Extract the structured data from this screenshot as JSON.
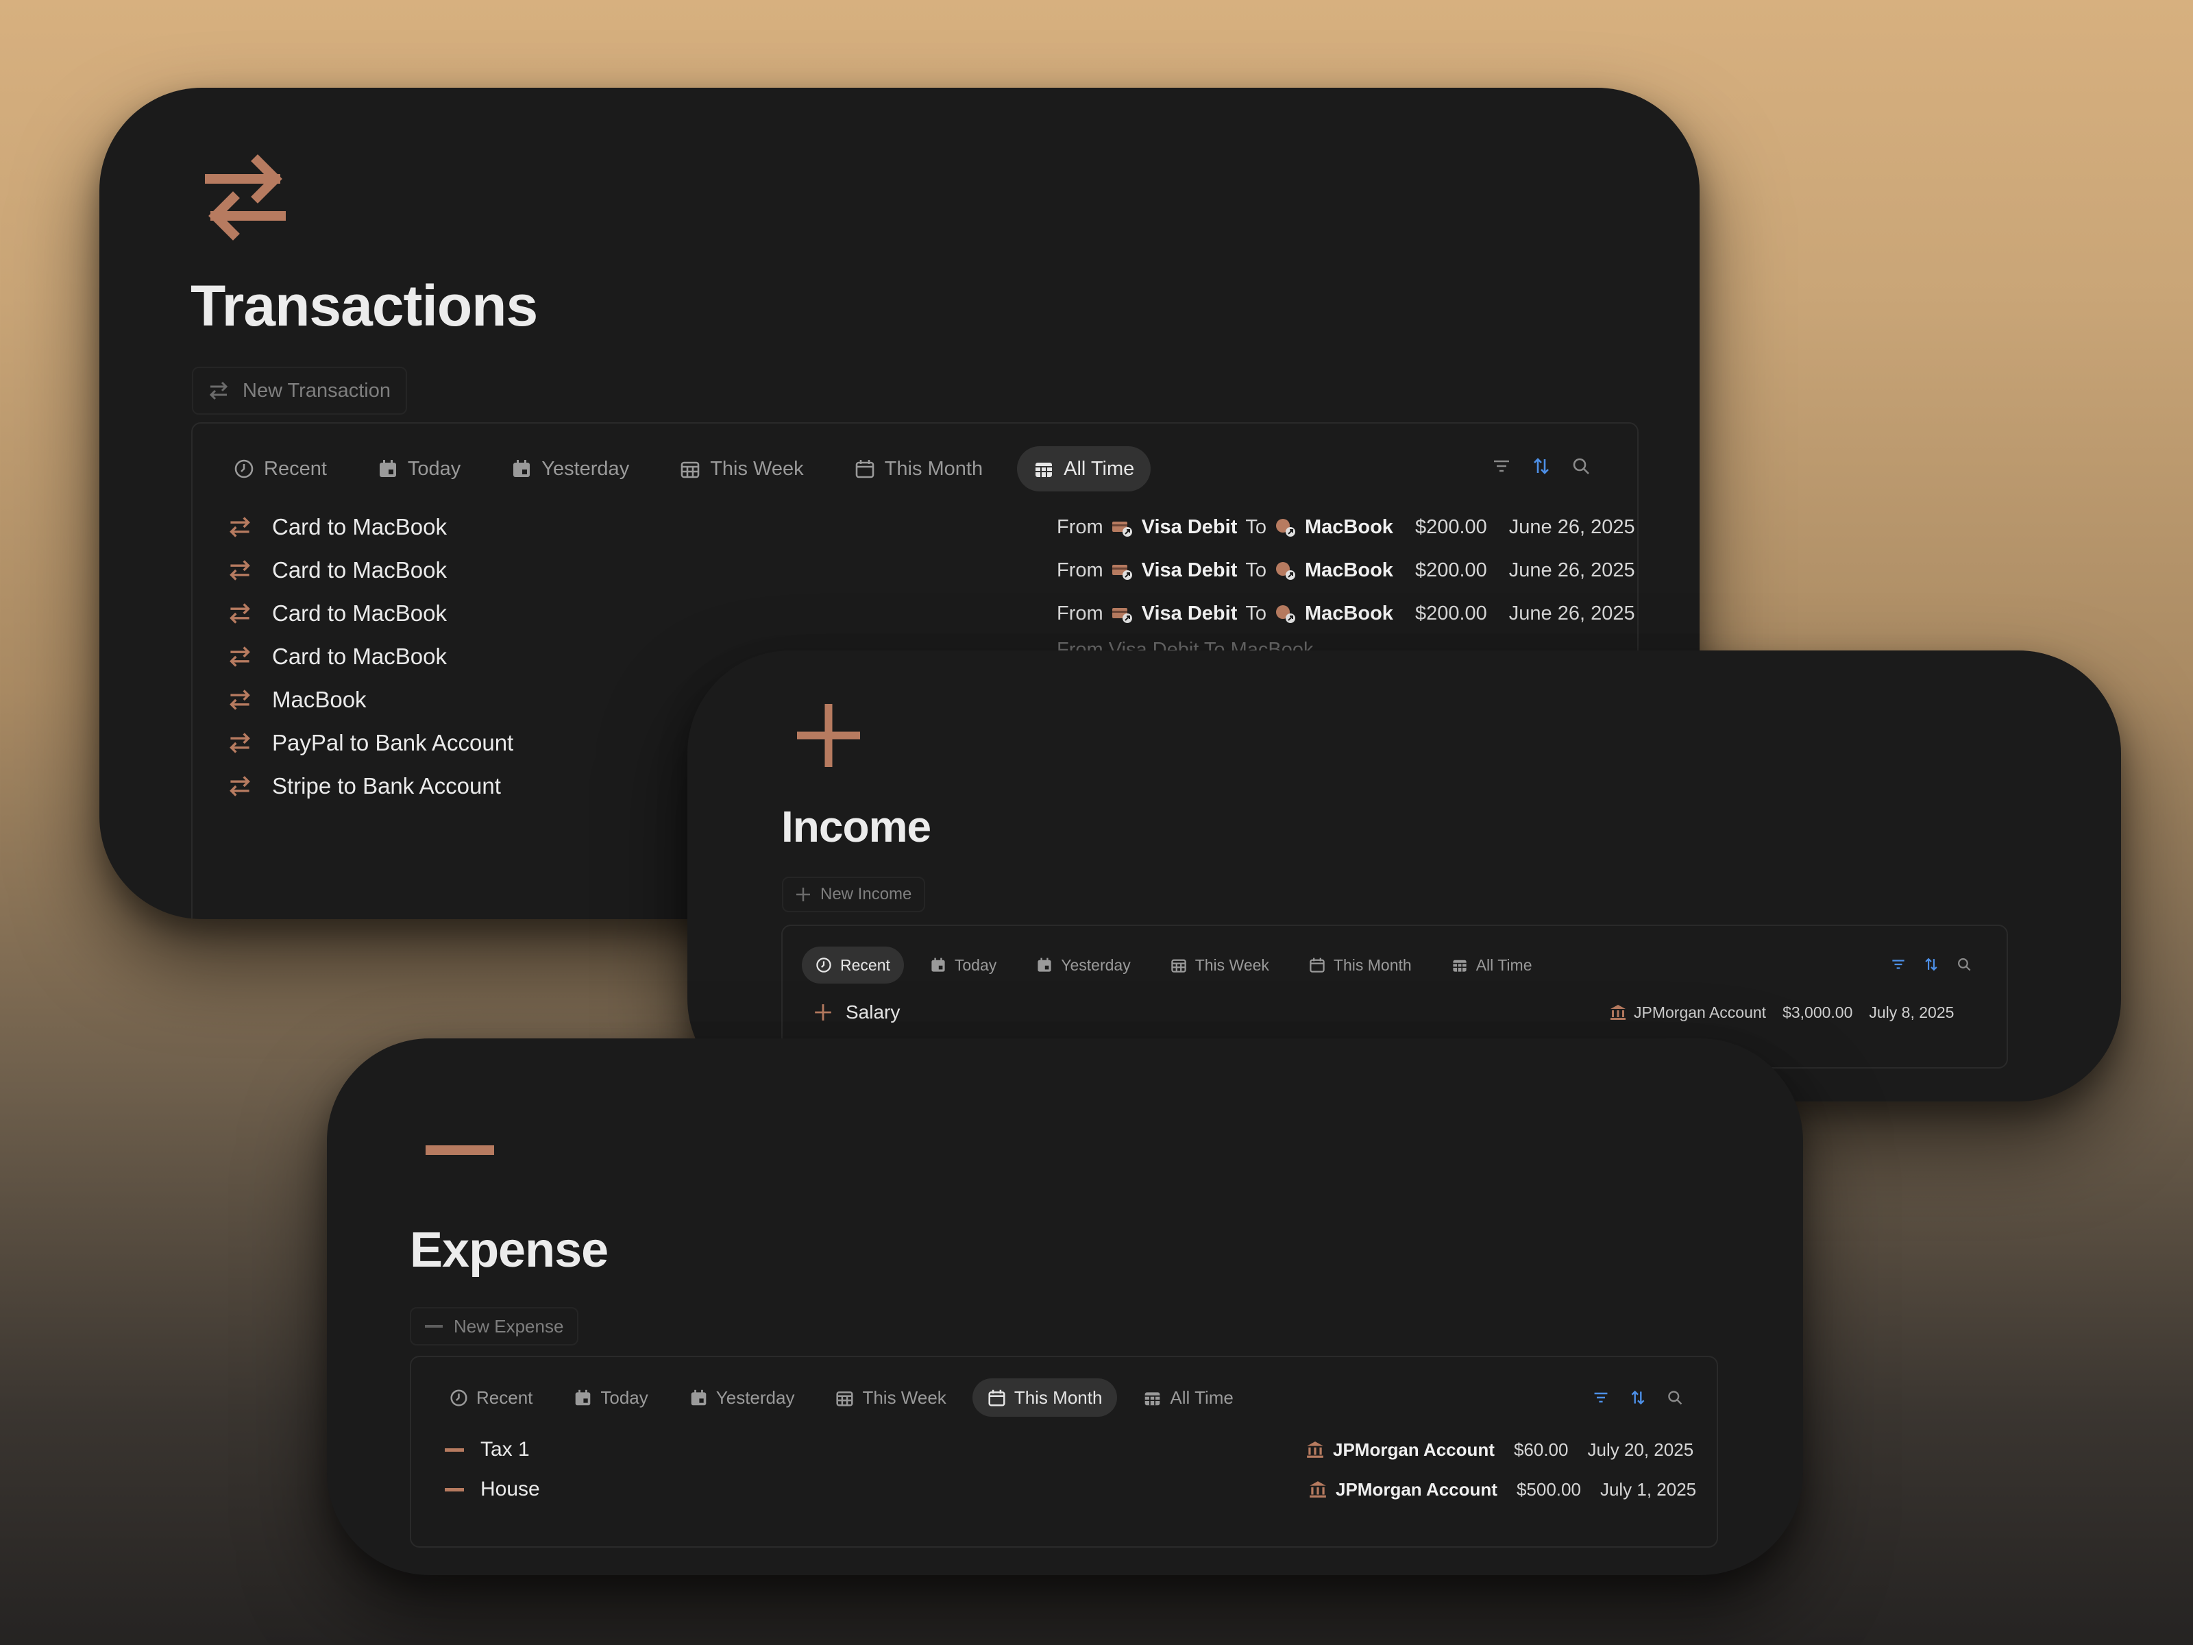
{
  "colors": {
    "accent": "#b77b60",
    "card_bg": "#1b1b1b",
    "active_tab_bg": "#323232",
    "tool_blue": "#4d8fe6"
  },
  "transactions": {
    "icon": "arrows-exchange-icon",
    "title": "Transactions",
    "new_label": "New Transaction",
    "tabs": [
      "Recent",
      "Today",
      "Yesterday",
      "This Week",
      "This Month",
      "All Time"
    ],
    "active_tab": "All Time",
    "rows": [
      {
        "title": "Card to MacBook",
        "from_label": "From",
        "from": "Visa Debit",
        "to_label": "To",
        "to": "MacBook",
        "amount": "$200.00",
        "date": "June 26, 2025"
      },
      {
        "title": "Card to MacBook",
        "from_label": "From",
        "from": "Visa Debit",
        "to_label": "To",
        "to": "MacBook",
        "amount": "$200.00",
        "date": "June 26, 2025"
      },
      {
        "title": "Card to MacBook",
        "from_label": "From",
        "from": "Visa Debit",
        "to_label": "To",
        "to": "MacBook",
        "amount": "$200.00",
        "date": "June 26, 2025"
      },
      {
        "title": "Card to MacBook"
      },
      {
        "title": "MacBook"
      },
      {
        "title": "PayPal to Bank Account"
      },
      {
        "title": "Stripe to Bank Account"
      }
    ],
    "partial_row_text": "From Visa Debit To MacBook"
  },
  "income": {
    "icon": "plus-icon",
    "title": "Income",
    "new_label": "New Income",
    "tabs": [
      "Recent",
      "Today",
      "Yesterday",
      "This Week",
      "This Month",
      "All Time"
    ],
    "active_tab": "Recent",
    "rows": [
      {
        "title": "Salary",
        "account": "JPMorgan Account",
        "amount": "$3,000.00",
        "date": "July 8, 2025"
      }
    ]
  },
  "expense": {
    "icon": "minus-icon",
    "title": "Expense",
    "new_label": "New Expense",
    "tabs": [
      "Recent",
      "Today",
      "Yesterday",
      "This Week",
      "This Month",
      "All Time"
    ],
    "active_tab": "This Month",
    "rows": [
      {
        "title": "Tax 1",
        "account": "JPMorgan Account",
        "amount": "$60.00",
        "date": "July 20, 2025"
      },
      {
        "title": "House",
        "account": "JPMorgan Account",
        "amount": "$500.00",
        "date": "July 1, 2025"
      }
    ]
  }
}
